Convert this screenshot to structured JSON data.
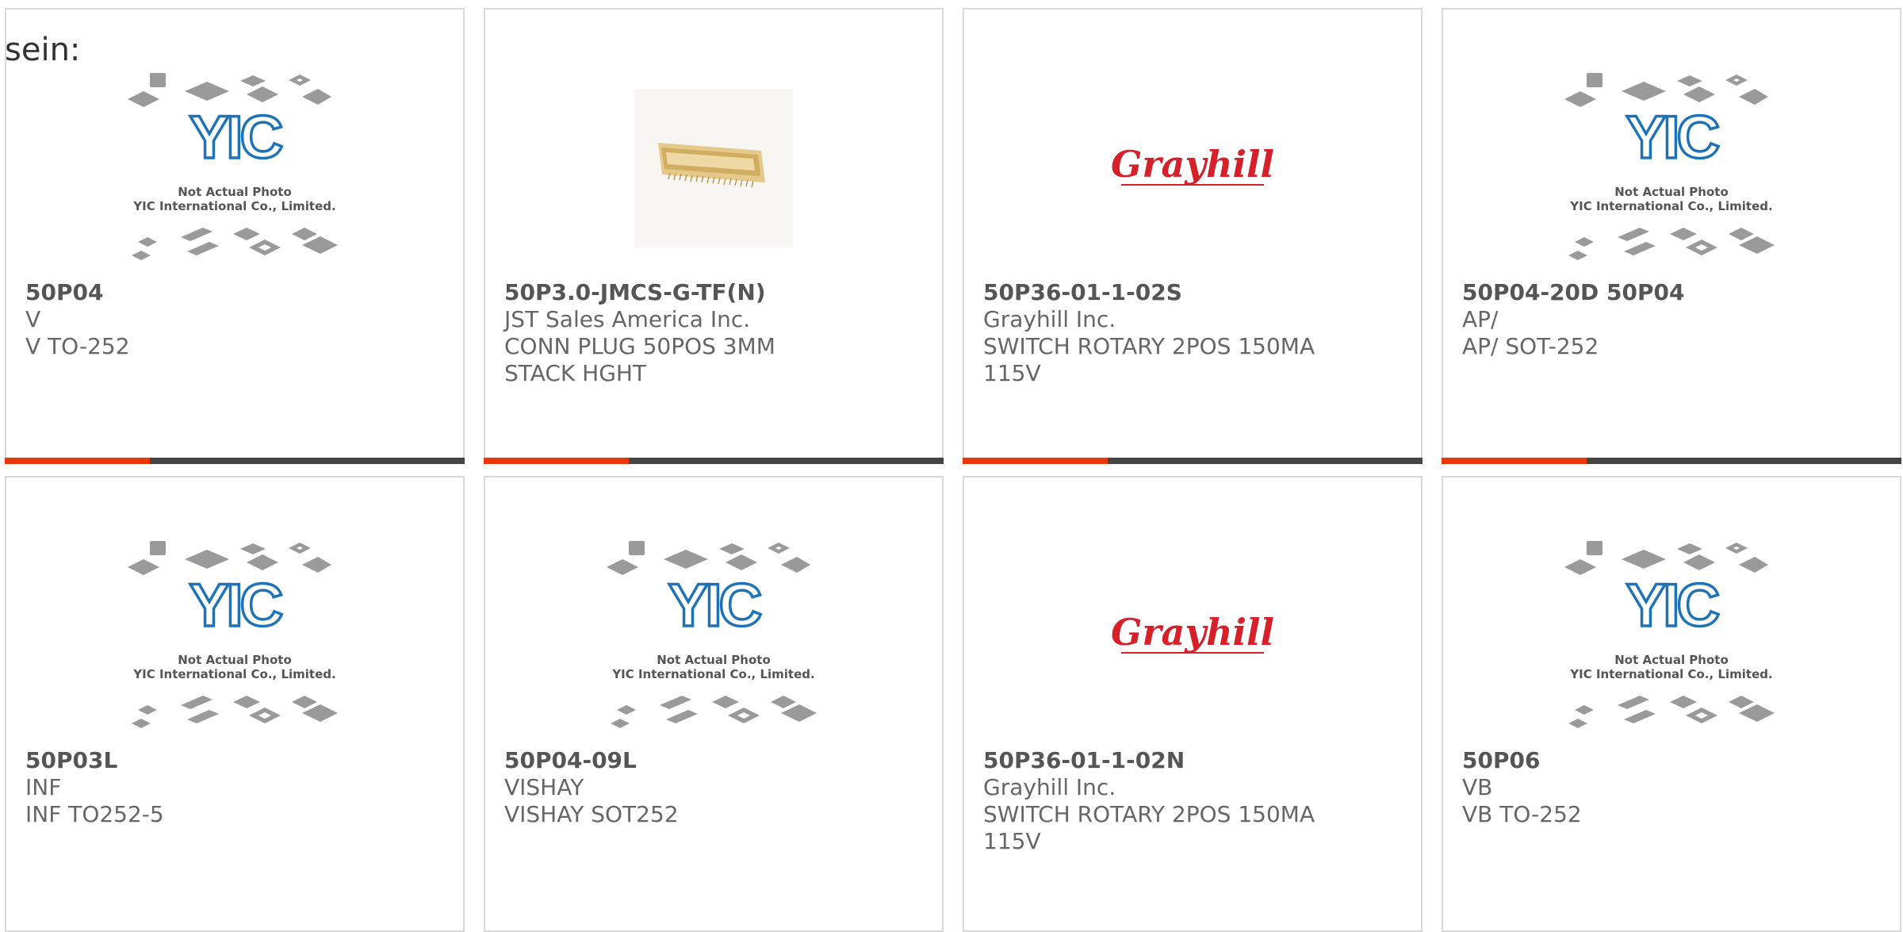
{
  "intro_text": "sein:",
  "placeholder_photo": {
    "line1": "Not Actual Photo",
    "line2": "YIC International Co., Limited.",
    "logo": "YIC"
  },
  "grayhill_logo": "Grayhill",
  "colors": {
    "accent": "#e8380d",
    "bar": "#444444",
    "yic_blue": "#1e73b8",
    "grayhill_red": "#d6212a"
  },
  "products": [
    {
      "part": "50P04",
      "maker": "V",
      "desc": "V TO-252",
      "image": "yic-placeholder"
    },
    {
      "part": "50P3.0-JMCS-G-TF(N)",
      "maker": "JST Sales America Inc.",
      "desc": "CONN PLUG 50POS 3MM STACK HGHT",
      "image": "connector-photo"
    },
    {
      "part": "50P36-01-1-02S",
      "maker": "Grayhill Inc.",
      "desc": "SWITCH ROTARY 2POS 150MA 115V",
      "image": "grayhill-logo"
    },
    {
      "part": "50P04-20D 50P04",
      "maker": "AP/",
      "desc": "AP/ SOT-252",
      "image": "yic-placeholder"
    },
    {
      "part": "50P03L",
      "maker": "INF",
      "desc": "INF TO252-5",
      "image": "yic-placeholder"
    },
    {
      "part": "50P04-09L",
      "maker": "VISHAY",
      "desc": "VISHAY SOT252",
      "image": "yic-placeholder"
    },
    {
      "part": "50P36-01-1-02N",
      "maker": "Grayhill Inc.",
      "desc": "SWITCH ROTARY 2POS 150MA 115V",
      "image": "grayhill-logo"
    },
    {
      "part": "50P06",
      "maker": "VB",
      "desc": "VB TO-252",
      "image": "yic-placeholder"
    }
  ]
}
